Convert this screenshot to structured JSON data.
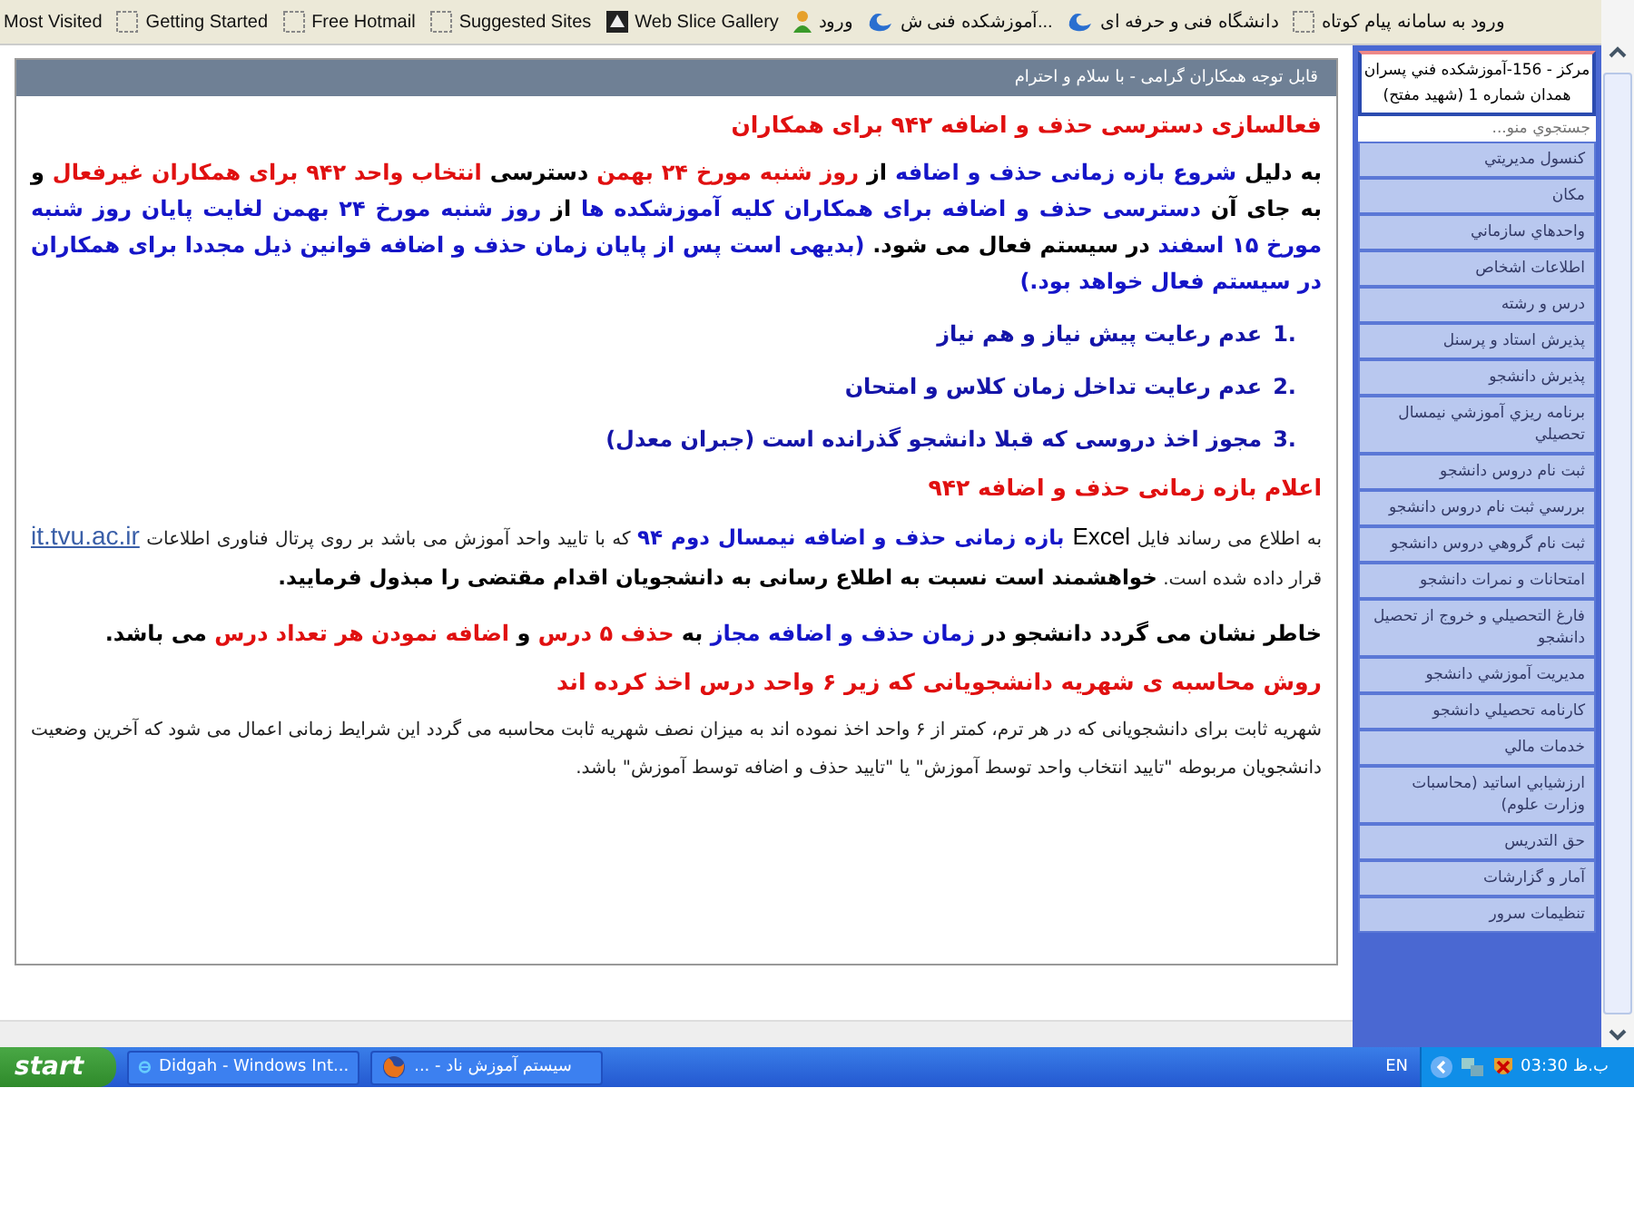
{
  "bookmarks": [
    {
      "label": "ورود به سامانه پیام کوتاه",
      "kind": "page"
    },
    {
      "label": "دانشگاه فنی و حرفه ای",
      "kind": "logo"
    },
    {
      "label": "آموزشکده فنی ش...",
      "kind": "logo"
    },
    {
      "label": "ورود",
      "kind": "user"
    },
    {
      "label": "Web Slice Gallery",
      "kind": "slice"
    },
    {
      "label": "Suggested Sites",
      "kind": "page"
    },
    {
      "label": "Free Hotmail",
      "kind": "page"
    },
    {
      "label": "Getting Started",
      "kind": "page"
    },
    {
      "label": "Most Visited",
      "kind": "none"
    }
  ],
  "panel": {
    "title": "قابل توجه همکاران گرامی - با سلام و احترام",
    "paragraphs": [
      {
        "kind": "heading",
        "runs": [
          {
            "color": "#e01010",
            "text": "فعالسازی دسترسی حذف و اضافه ۹۴۲ برای همکاران"
          }
        ]
      },
      {
        "kind": "body",
        "runs": [
          {
            "color": "#000000",
            "text": "به دلیل "
          },
          {
            "color": "#1515c8",
            "text": "شروع بازه زمانی حذف و اضافه"
          },
          {
            "color": "#000000",
            "text": " از "
          },
          {
            "color": "#e01010",
            "text": "روز شنبه مورخ ۲۴ بهمن"
          },
          {
            "color": "#000000",
            "text": " دسترسی "
          },
          {
            "color": "#e01010",
            "text": "انتخاب واحد ۹۴۲ برای همکاران غیرفعال"
          },
          {
            "color": "#000000",
            "text": " و به جای آن "
          },
          {
            "color": "#1515c8",
            "text": "دسترسی حذف و اضافه برای همکاران کلیه آموزشکده ها"
          },
          {
            "color": "#000000",
            "text": " از "
          },
          {
            "color": "#1515c8",
            "text": "روز شنبه مورخ ۲۴ بهمن لغایت پایان روز شنبه مورخ ۱۵ اسفند"
          },
          {
            "color": "#000000",
            "text": " در سیستم فعال می شود. "
          },
          {
            "color": "#1515c8",
            "text": "(بدیهی است پس از پایان زمان حذف و اضافه قوانین ذیل مجددا برای همکاران در سیستم فعال خواهد بود.)"
          }
        ]
      },
      {
        "kind": "item",
        "number": "1.",
        "runs": [
          {
            "color": "#1515a8",
            "text": "عدم رعایت پیش نیاز و هم نیاز"
          }
        ]
      },
      {
        "kind": "item",
        "number": "2.",
        "runs": [
          {
            "color": "#1515a8",
            "text": "عدم رعایت تداخل زمان کلاس و امتحان"
          }
        ]
      },
      {
        "kind": "item",
        "number": "3.",
        "runs": [
          {
            "color": "#1515a8",
            "text": "مجوز اخذ دروسی که قبلا دانشجو گذرانده است (جبران معدل)"
          }
        ]
      },
      {
        "kind": "heading",
        "runs": [
          {
            "color": "#e01010",
            "text": "اعلام بازه زمانی حذف و اضافه ۹۴۲"
          }
        ]
      },
      {
        "kind": "small",
        "runs": [
          {
            "color": "#222222",
            "text": "به اطلاع می رساند فایل "
          },
          {
            "color": "#000000",
            "kind": "latin",
            "text": "Excel"
          },
          {
            "color": "#1515c8",
            "kind": "strong",
            "text": " بازه زمانی حذف و اضافه نیمسال دوم ۹۴"
          },
          {
            "color": "#222222",
            "text": " که با تایید واحد آموزش می باشد بر روی پرتال فناوری اطلاعات "
          },
          {
            "color": "#3a5fa8",
            "kind": "link",
            "text": "it.tvu.ac.ir"
          },
          {
            "color": "#222222",
            "text": " قرار داده شده است. "
          },
          {
            "color": "#000000",
            "kind": "strong",
            "text": "خواهشمند است نسبت به اطلاع رسانی به دانشجویان اقدام مقتضی را مبذول فرمایید."
          }
        ]
      },
      {
        "kind": "body",
        "runs": [
          {
            "color": "#000000",
            "text": "خاطر نشان می گردد دانشجو در "
          },
          {
            "color": "#1515c8",
            "text": "زمان حذف و اضافه مجاز"
          },
          {
            "color": "#000000",
            "text": " به "
          },
          {
            "color": "#e01010",
            "text": "حذف ۵ درس"
          },
          {
            "color": "#000000",
            "text": " و "
          },
          {
            "color": "#e01010",
            "text": "اضافه نمودن هر تعداد درس"
          },
          {
            "color": "#000000",
            "text": " می باشد."
          }
        ]
      },
      {
        "kind": "heading",
        "runs": [
          {
            "color": "#e01010",
            "text": "روش محاسبه ی شهریه دانشجویانی که زیر ۶ واحد درس اخذ کرده اند"
          }
        ]
      },
      {
        "kind": "small",
        "runs": [
          {
            "color": "#222222",
            "text": "شهریه ثابت برای دانشجویانی که در هر ترم، کمتر از ۶ واحد اخذ نموده اند به میزان نصف شهریه ثابت محاسبه می گردد این شرایط زمانی اعمال می شود که آخرین وضعیت دانشجویان مربوطه \"تایید انتخاب واحد توسط آموزش\" یا \"تایید حذف و اضافه توسط آموزش\" باشد."
          }
        ]
      }
    ]
  },
  "sidebar": {
    "center": "مرکز - 156-آموزشکده فني پسران همدان شماره 1 (شهيد مفتح)",
    "search": {
      "placeholder": "جستجوي منو..."
    },
    "items": [
      "کنسول مديريتي",
      "مکان",
      "واحدهاي سازماني",
      "اطلاعات اشخاص",
      "درس و رشته",
      "پذيرش استاد و پرسنل",
      "پذيرش دانشجو",
      "برنامه ريزي آموزشي نيمسال تحصيلي",
      "ثبت نام دروس دانشجو",
      "بررسي ثبت نام دروس دانشجو",
      "ثبت نام گروهي دروس دانشجو",
      "امتحانات و نمرات دانشجو",
      "فارغ التحصيلي و خروج از تحصيل دانشجو",
      "مديريت آموزشي دانشجو",
      "کارنامه تحصيلي دانشجو",
      "خدمات مالي",
      "ارزشيابي اساتيد (محاسبات وزارت علوم)",
      "حق التدريس",
      "آمار و گزارشات",
      "تنظيمات سرور"
    ]
  },
  "taskbar": {
    "start": "start",
    "tasks": [
      {
        "label": "سیستم آموزش ناد - ...",
        "kind": "firefox"
      },
      {
        "label": "Didgah - Windows Int...",
        "kind": "ie"
      }
    ],
    "language": "EN",
    "clock": "03:30 ب.ظ"
  }
}
